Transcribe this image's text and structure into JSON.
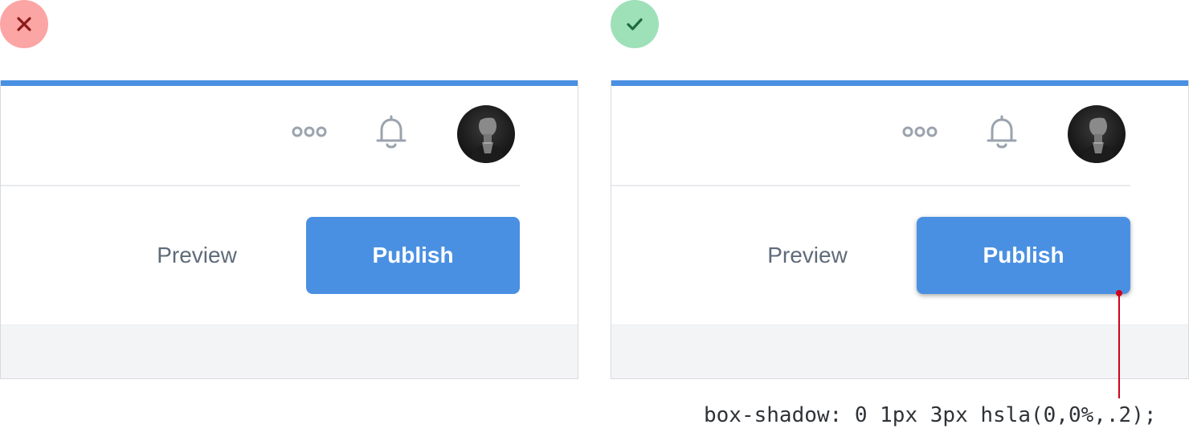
{
  "bad_example": {
    "icon": "x-mark-icon",
    "color": "#fca5a5",
    "preview_label": "Preview",
    "publish_label": "Publish"
  },
  "good_example": {
    "icon": "checkmark-icon",
    "color": "#9ee0b8",
    "preview_label": "Preview",
    "publish_label": "Publish"
  },
  "header_icons": [
    "more-horizontal-icon",
    "bell-icon",
    "avatar"
  ],
  "accent_color": "#4a90e2",
  "annotation": {
    "code": "box-shadow: 0 1px 3px hsla(0,0%,.2);",
    "line_color": "#d0021b"
  }
}
